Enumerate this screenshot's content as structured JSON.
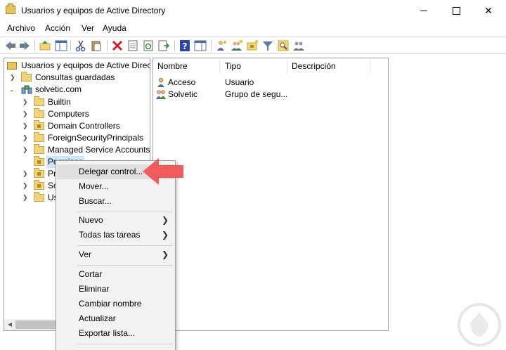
{
  "window": {
    "title": "Usuarios y equipos de Active Directory"
  },
  "menubar": {
    "items": [
      "Archivo",
      "Acción",
      "Ver",
      "Ayuda"
    ]
  },
  "toolbar": {
    "icons": [
      "back-icon",
      "forward-icon",
      "up-folder-icon",
      "show-console-tree-icon",
      "cut-icon",
      "paste-icon",
      "delete-icon",
      "properties-icon",
      "refresh-icon",
      "export-list-icon",
      "help-icon",
      "action-pane-icon",
      "new-user-icon",
      "new-group-icon",
      "new-ou-icon",
      "filter-icon",
      "find-icon",
      "add-to-group-icon"
    ]
  },
  "tree": {
    "root": "Usuarios y equipos de Active Directory",
    "saved_queries": "Consultas guardadas",
    "domain": "solvetic.com",
    "children": [
      {
        "label": "Builtin",
        "ou": false
      },
      {
        "label": "Computers",
        "ou": false
      },
      {
        "label": "Domain Controllers",
        "ou": true
      },
      {
        "label": "ForeignSecurityPrincipals",
        "ou": false
      },
      {
        "label": "Managed Service Accounts",
        "ou": false
      },
      {
        "label": "Permisos",
        "ou": true
      },
      {
        "label": "Pr",
        "ou": true
      },
      {
        "label": "So",
        "ou": true
      },
      {
        "label": "Us",
        "ou": false
      }
    ]
  },
  "list": {
    "columns": [
      "Nombre",
      "Tipo",
      "Descripción"
    ],
    "rows": [
      {
        "name": "Acceso",
        "type": "Usuario",
        "description": ""
      },
      {
        "name": "Solvetic",
        "type": "Grupo de segu...",
        "description": ""
      }
    ]
  },
  "context_menu": {
    "items": [
      {
        "label": "Delegar control...",
        "submenu": false
      },
      {
        "label": "Mover...",
        "submenu": false
      },
      {
        "label": "Buscar...",
        "submenu": false
      },
      {
        "label": "Nuevo",
        "submenu": true
      },
      {
        "label": "Todas las tareas",
        "submenu": true
      },
      {
        "label": "Ver",
        "submenu": true
      },
      {
        "label": "Cortar",
        "submenu": false
      },
      {
        "label": "Eliminar",
        "submenu": false
      },
      {
        "label": "Cambiar nombre",
        "submenu": false
      },
      {
        "label": "Actualizar",
        "submenu": false
      },
      {
        "label": "Exportar lista...",
        "submenu": false
      }
    ]
  },
  "colors": {
    "callout_arrow": "#f15b5b",
    "selection": "#cce8ff",
    "menu_bg": "#f2f2f2"
  }
}
